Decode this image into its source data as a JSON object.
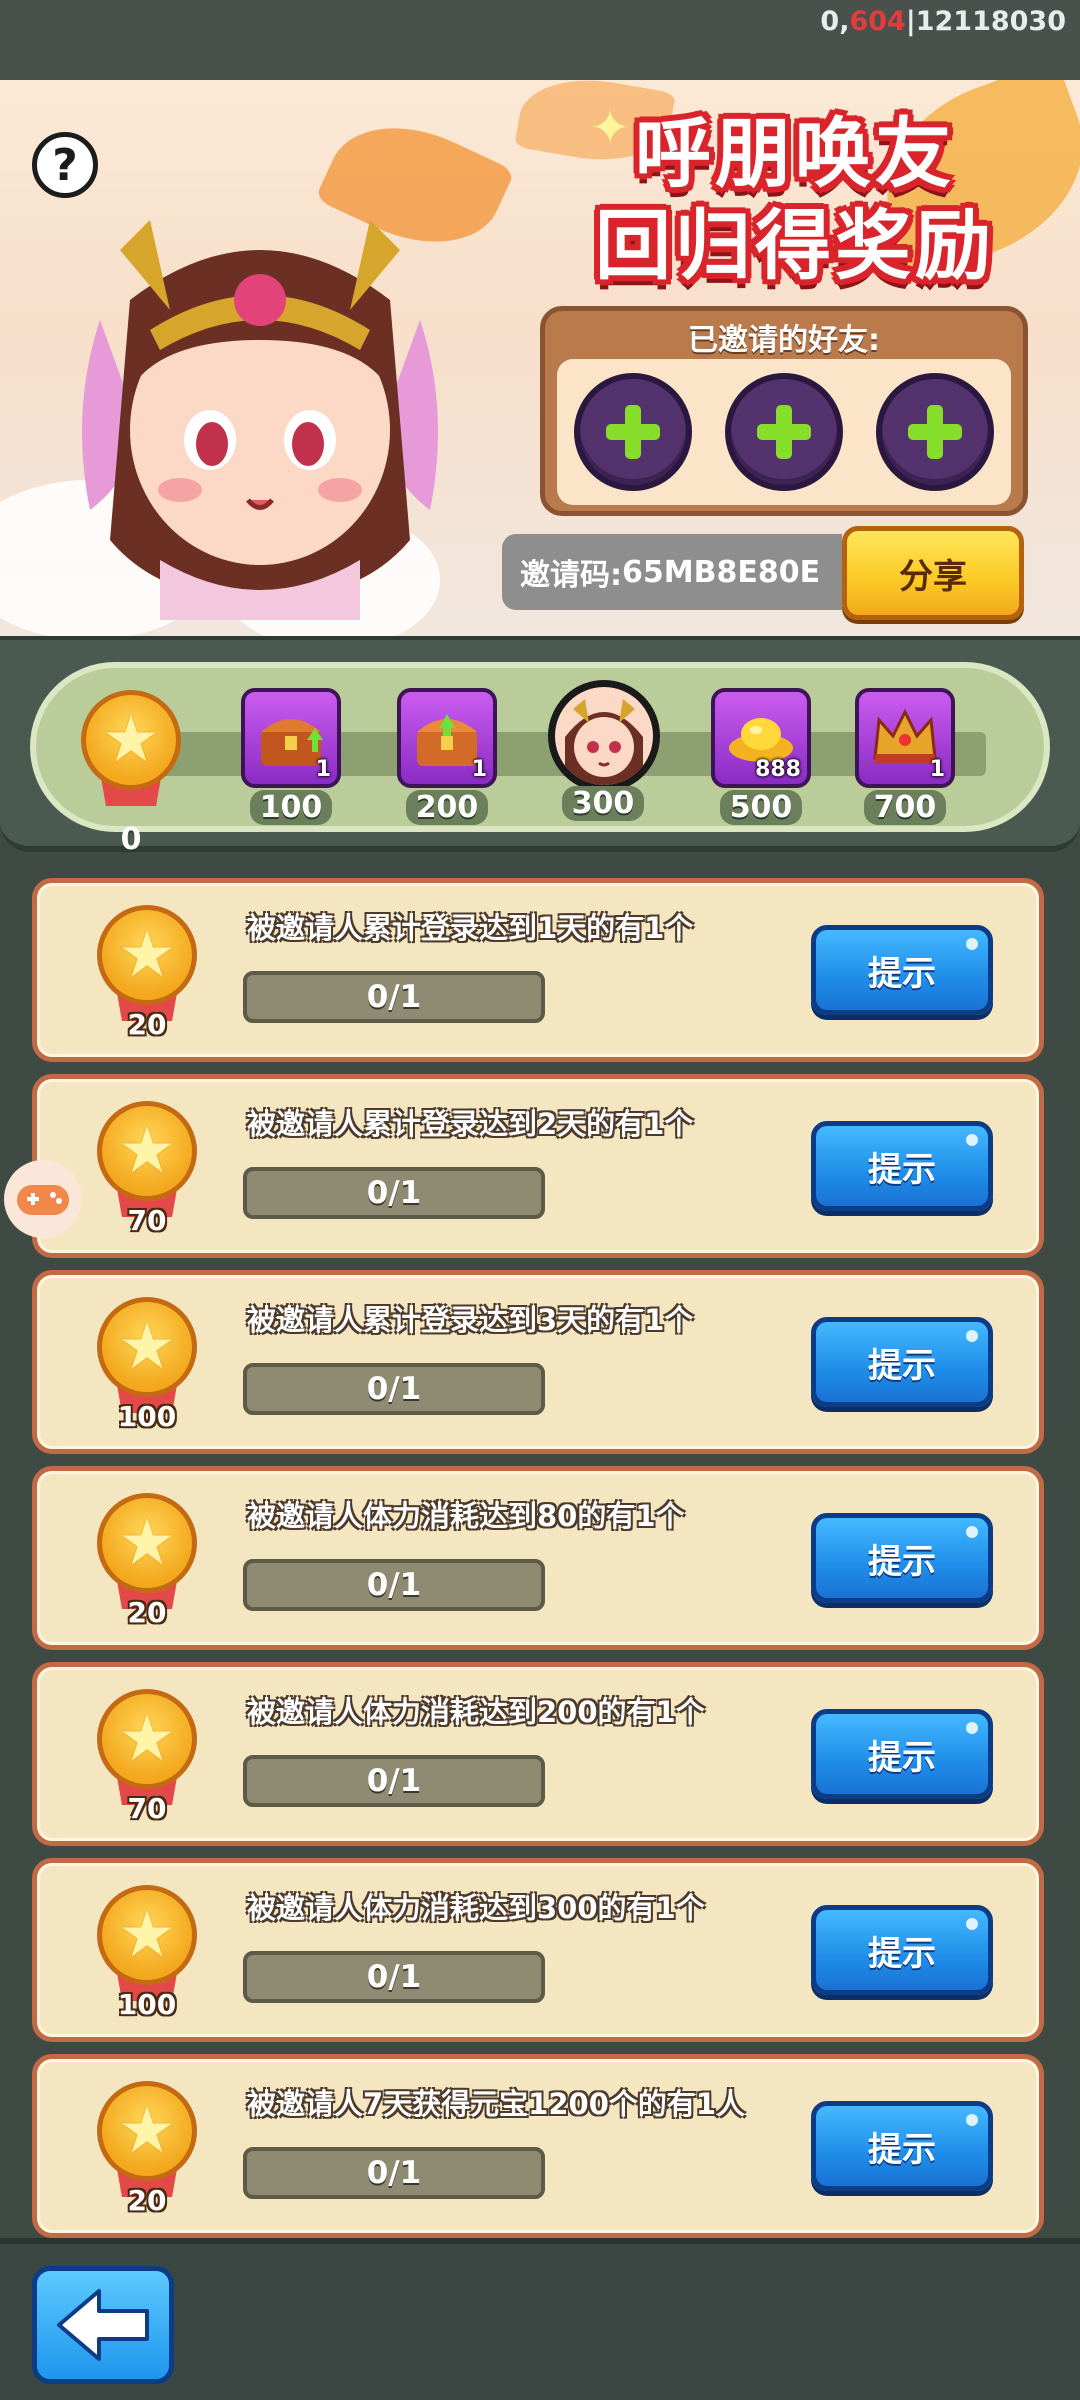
{
  "status": {
    "prefix": "0,",
    "highlight": "604",
    "suffix": "|12118030"
  },
  "banner": {
    "title_line1": "呼朋唤友",
    "title_line2": "回归得奖励",
    "friends_title": "已邀请的好友:",
    "invite_label": "邀请码:",
    "invite_code": "65MB8E80E",
    "share_label": "分享",
    "help_label": "?"
  },
  "track": {
    "milestones": [
      {
        "value": "0",
        "reward": "star-medal"
      },
      {
        "value": "100",
        "reward": "upgrade-chest-icon",
        "count": "1"
      },
      {
        "value": "200",
        "reward": "upgrade-chest-icon",
        "count": "1"
      },
      {
        "value": "300",
        "reward": "hero-portrait-icon"
      },
      {
        "value": "500",
        "reward": "gold-ingot-icon",
        "count": "888"
      },
      {
        "value": "700",
        "reward": "crown-icon",
        "count": "1"
      }
    ]
  },
  "tasks": [
    {
      "title": "被邀请人累计登录达到1天的有1个",
      "progress": "0/1",
      "reward": "20",
      "button": "提示"
    },
    {
      "title": "被邀请人累计登录达到2天的有1个",
      "progress": "0/1",
      "reward": "70",
      "button": "提示"
    },
    {
      "title": "被邀请人累计登录达到3天的有1个",
      "progress": "0/1",
      "reward": "100",
      "button": "提示"
    },
    {
      "title": "被邀请人体力消耗达到80的有1个",
      "progress": "0/1",
      "reward": "20",
      "button": "提示"
    },
    {
      "title": "被邀请人体力消耗达到200的有1个",
      "progress": "0/1",
      "reward": "70",
      "button": "提示"
    },
    {
      "title": "被邀请人体力消耗达到300的有1个",
      "progress": "0/1",
      "reward": "100",
      "button": "提示"
    },
    {
      "title": "被邀请人7天获得元宝1200个的有1人",
      "progress": "0/1",
      "reward": "20",
      "button": "提示"
    }
  ],
  "colors": {
    "accent_blue": "#1f8de8",
    "accent_yellow": "#fbc925",
    "card_bg": "#f5e6c2",
    "card_border": "#c26a46"
  }
}
